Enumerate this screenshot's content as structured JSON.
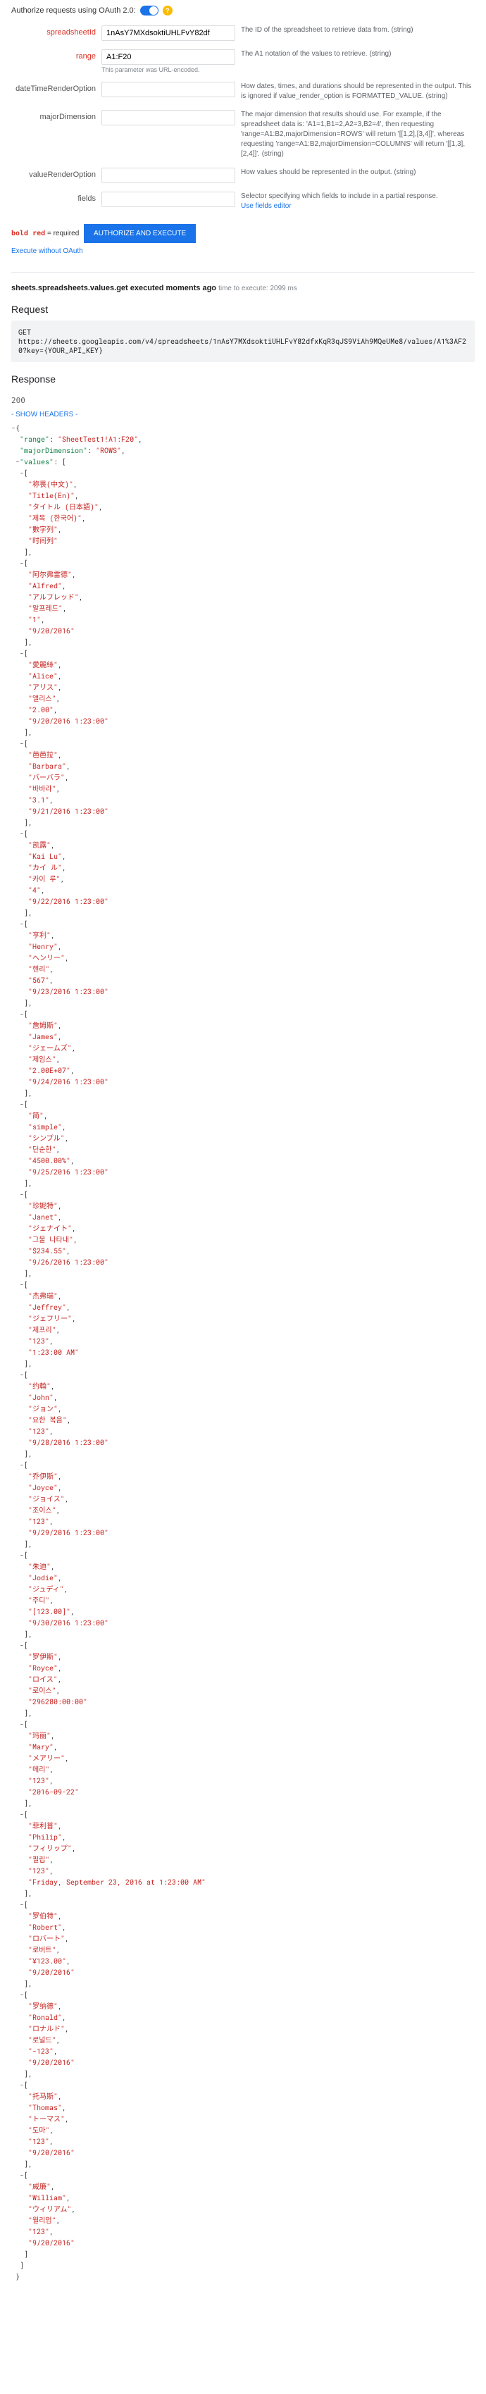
{
  "auth": {
    "label": "Authorize requests using OAuth 2.0:"
  },
  "params": [
    {
      "name": "spreadsheetId",
      "required": true,
      "value": "1nAsY7MXdsoktiUHLFvY82df",
      "desc": "The ID of the spreadsheet to retrieve data from. (string)"
    },
    {
      "name": "range",
      "required": true,
      "value": "A1:F20",
      "desc": "The A1 notation of the values to retrieve. (string)",
      "hint": "This parameter was URL-encoded."
    },
    {
      "name": "dateTimeRenderOption",
      "required": false,
      "value": "",
      "desc": "How dates, times, and durations should be represented in the output. This is ignored if value_render_option is FORMATTED_VALUE. (string)"
    },
    {
      "name": "majorDimension",
      "required": false,
      "value": "",
      "desc": "The major dimension that results should use. For example, if the spreadsheet data is: 'A1=1,B1=2,A2=3,B2=4', then requesting 'range=A1:B2,majorDimension=ROWS' will return '[[1,2],[3,4]]', whereas requesting 'range=A1:B2,majorDimension=COLUMNS' will return '[[1,3],[2,4]]'. (string)"
    },
    {
      "name": "valueRenderOption",
      "required": false,
      "value": "",
      "desc": "How values should be represented in the output. (string)"
    },
    {
      "name": "fields",
      "required": false,
      "value": "",
      "desc": "Selector specifying which fields to include in a partial response.",
      "linkText": "Use fields editor"
    }
  ],
  "legend": {
    "boldRed": "bold red",
    "eq": " = required",
    "btn": "AUTHORIZE AND EXECUTE",
    "link": "Execute without OAuth"
  },
  "executed": {
    "title": "sheets.spreadsheets.values.get executed moments ago",
    "time": "time to execute: 2099 ms"
  },
  "request": {
    "heading": "Request",
    "body": "GET\nhttps://sheets.googleapis.com/v4/spreadsheets/1nAsY7MXdsoktiUHLFvY82dfxKqR3qJS9ViAh9MQeUMe8/values/A1%3AF20?key={YOUR_API_KEY}"
  },
  "response": {
    "heading": "Response",
    "status": "200",
    "showHeaders": "- SHOW HEADERS -"
  },
  "chart_data": {
    "type": "table",
    "range": "SheetTest1!A1:F20",
    "majorDimension": "ROWS",
    "values": [
      [
        "称畏(中文)",
        "Title(En)",
        "タイトル (日本語)",
        "제목 (한국어)",
        "數字列",
        "时间列"
      ],
      [
        "阿尔弗雷德",
        "Alfred",
        "アルフレッド",
        "알프레드",
        "1",
        "9/20/2016"
      ],
      [
        "愛麗絲",
        "Alice",
        "アリス",
        "앨리스",
        "2.00",
        "9/20/2016 1:23:00"
      ],
      [
        "芭芭拉",
        "Barbara",
        "バーバラ",
        "바바라",
        "3.1",
        "9/21/2016 1:23:00"
      ],
      [
        "凯露",
        "Kai Lu",
        "カイ ル",
        "카이 루",
        "4",
        "9/22/2016 1:23:00"
      ],
      [
        "亨利",
        "Henry",
        "ヘンリー",
        "헨리",
        "567",
        "9/23/2016 1:23:00"
      ],
      [
        "詹姆斯",
        "James",
        "ジェームズ",
        "제임스",
        "2.00E+07",
        "9/24/2016 1:23:00"
      ],
      [
        "简",
        "simple",
        "シンプル",
        "단순한",
        "4500.00%",
        "9/25/2016 1:23:00"
      ],
      [
        "珍妮特",
        "Janet",
        "ジェナイト",
        "그물 나타내",
        "$234.55",
        "9/26/2016 1:23:00"
      ],
      [
        "杰弗瑞",
        "Jeffrey",
        "ジェフリー",
        "제프리",
        "123",
        "1:23:00 AM"
      ],
      [
        "约翰",
        "John",
        "ジョン",
        "요한 복음",
        "123",
        "9/28/2016 1:23:00"
      ],
      [
        "乔伊斯",
        "Joyce",
        "ジョイス",
        "조이스",
        "123",
        "9/29/2016 1:23:00"
      ],
      [
        "朱迪",
        "Jodie",
        "ジュディ",
        "주디",
        "[123.00]",
        "9/30/2016 1:23:00"
      ],
      [
        "罗伊斯",
        "Royce",
        "ロイス",
        "로이스",
        "296280:00:00"
      ],
      [
        "玛丽",
        "Mary",
        "メアリー",
        "메리",
        "123",
        "2016-09-22"
      ],
      [
        "菲利普",
        "Philip",
        "フィリップ",
        "필립",
        "123",
        "Friday, September 23, 2016 at 1:23:00 AM"
      ],
      [
        "罗伯特",
        "Robert",
        "ロバート",
        "로버트",
        "¥123.00",
        "9/20/2016"
      ],
      [
        "罗纳德",
        "Ronald",
        "ロナルド",
        "로널드",
        "-123",
        "9/20/2016"
      ],
      [
        "托马斯",
        "Thomas",
        "トーマス",
        "도마",
        "123",
        "9/20/2016"
      ],
      [
        "威廉",
        "William",
        "ウィリアム",
        "윌리엄",
        "123",
        "9/20/2016"
      ]
    ]
  }
}
